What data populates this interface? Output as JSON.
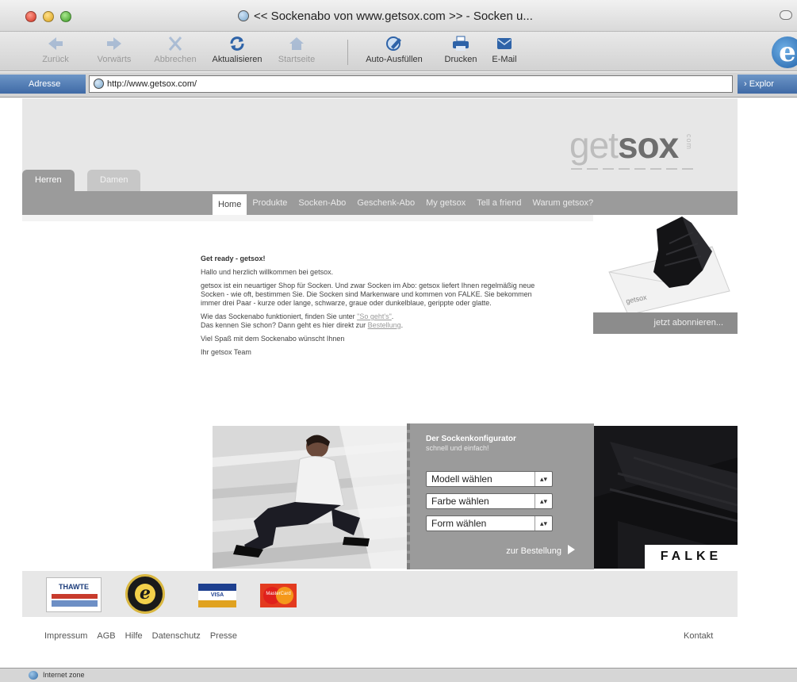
{
  "window": {
    "title": "<< Sockenabo von www.getsox.com >> - Socken u..."
  },
  "toolbar": {
    "back": "Zurück",
    "forward": "Vorwärts",
    "stop": "Abbrechen",
    "refresh": "Aktualisieren",
    "home": "Startseite",
    "autofill": "Auto-Ausfüllen",
    "print": "Drucken",
    "mail": "E-Mail"
  },
  "address_bar": {
    "label": "Adresse",
    "url": "http://www.getsox.com/",
    "explorer_label": "Explor"
  },
  "site": {
    "logo_main": "get",
    "logo_bold": "sox",
    "logo_suffix": "com",
    "gender_tabs": [
      "Herren",
      "Damen"
    ],
    "nav": [
      "Home",
      "Produkte",
      "Socken-Abo",
      "Geschenk-Abo",
      "My getsox",
      "Tell a friend",
      "Warum getsox?"
    ],
    "intro": {
      "title": "Get ready - getsox!",
      "welcome": "Hallo und herzlich willkommen bei getsox.",
      "para1": "getsox ist ein neuartiger Shop für Socken. Und zwar Socken im Abo: getsox liefert Ihnen regelmäßig neue Socken - wie oft, bestimmen Sie. Die Socken sind Markenware und kommen von FALKE. Sie bekommen immer drei Paar - kurze oder lange, schwarze, graue oder dunkelblaue, gerippte oder glatte.",
      "para2_pre": "Wie das Sockenabo funktioniert, finden Sie unter ",
      "para2_link": "\"So geht's\"",
      "para2_post": ".",
      "para3_pre": "Das kennen Sie schon? Dann geht es hier direkt zur ",
      "para3_link": "Bestellung",
      "para3_post": ".",
      "closing": "Viel Spaß mit dem Sockenabo wünscht Ihnen",
      "signature": "Ihr getsox Team"
    },
    "promo_label": "jetzt abonnieren...",
    "promo_envelope_text": "getsox",
    "configurator": {
      "title": "Der Sockenkonfigurator",
      "subtitle": "schnell und einfach!",
      "select_model": "Modell wählen",
      "select_color": "Farbe wählen",
      "select_form": "Form wählen",
      "order_label": "zur Bestellung"
    },
    "brand": "FALKE",
    "badges": {
      "trust_label": "THAWTE",
      "visa": "VISA",
      "mastercard": "MasterCard"
    },
    "footer_links": [
      "Impressum",
      "AGB",
      "Hilfe",
      "Datenschutz",
      "Presse"
    ],
    "contact": "Kontakt"
  },
  "statusbar": {
    "text": "Internet zone"
  },
  "colors": {
    "nav_grey": "#9b9b9b",
    "band_grey": "#e7e7e7",
    "ie_blue": "#3f6aa6"
  }
}
